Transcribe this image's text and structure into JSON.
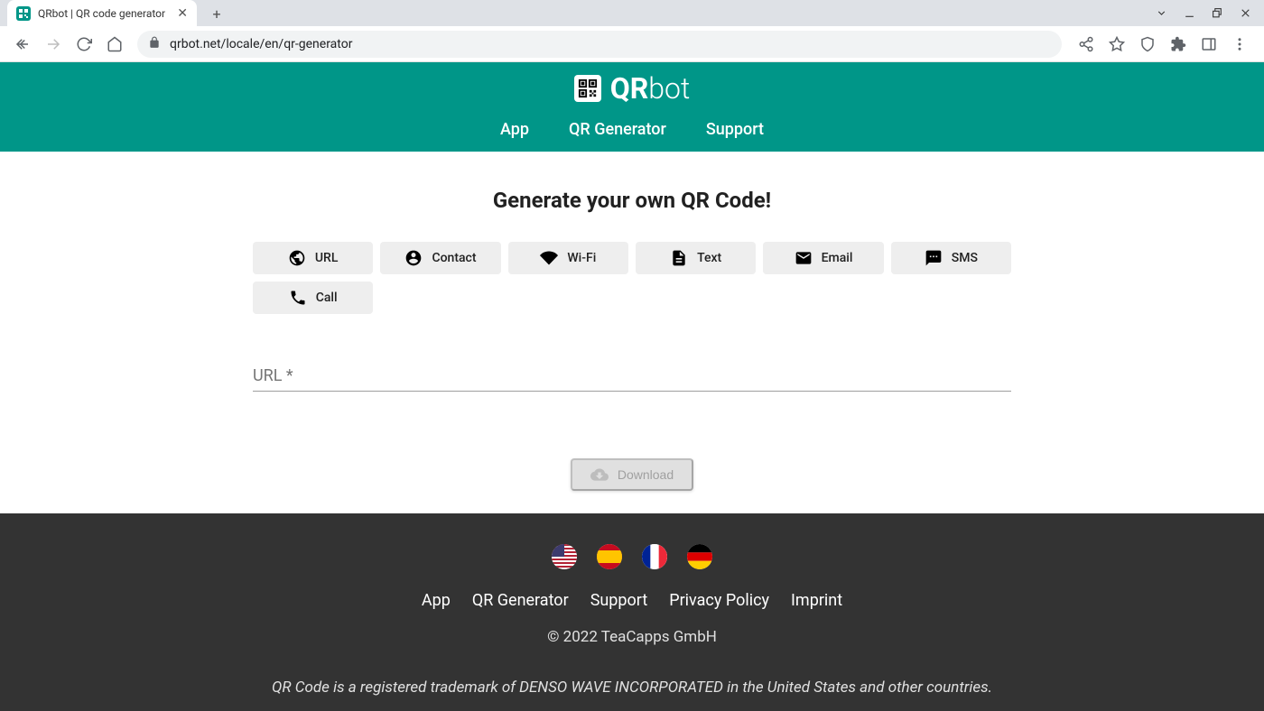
{
  "browser": {
    "tab_title": "QRbot | QR code generator",
    "url": "qrbot.net/locale/en/qr-generator"
  },
  "header": {
    "logo_bold": "QR",
    "logo_light": "bot",
    "nav": [
      "App",
      "QR Generator",
      "Support"
    ]
  },
  "main": {
    "title": "Generate your own QR Code!",
    "types": [
      "URL",
      "Contact",
      "Wi-Fi",
      "Text",
      "Email",
      "SMS",
      "Call"
    ],
    "url_label": "URL *",
    "url_value": "",
    "download_label": "Download"
  },
  "footer": {
    "languages": [
      "us",
      "es",
      "fr",
      "de"
    ],
    "nav": [
      "App",
      "QR Generator",
      "Support",
      "Privacy Policy",
      "Imprint"
    ],
    "copyright": "© 2022 TeaCapps GmbH",
    "trademark": "QR Code is a registered trademark of DENSO WAVE INCORPORATED in the United States and other countries."
  }
}
